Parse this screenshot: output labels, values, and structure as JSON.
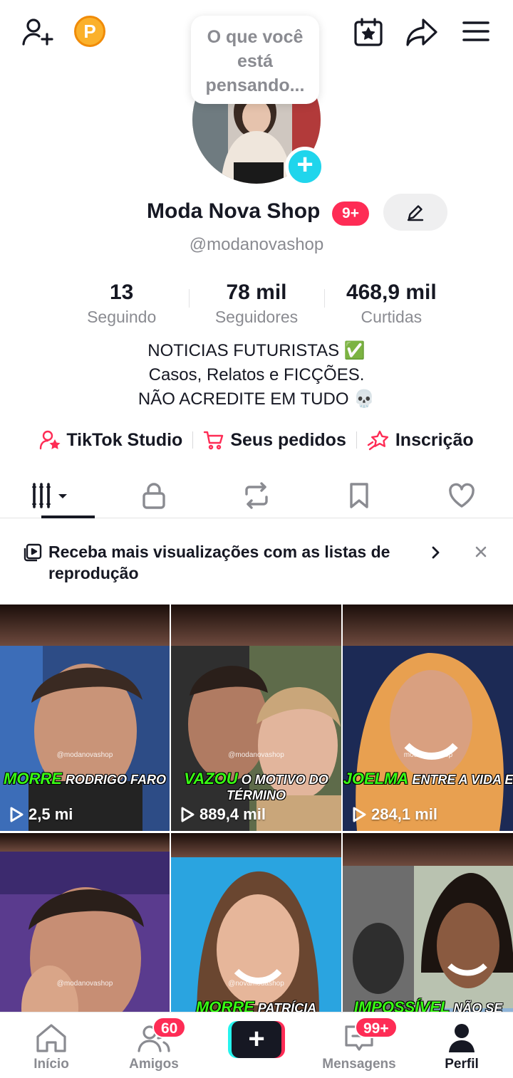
{
  "header": {
    "coin_letter": "P",
    "thought_bubble": "O que você está pensando..."
  },
  "profile": {
    "display_name": "Moda Nova Shop",
    "name_badge": "9+",
    "handle": "@modanovashop"
  },
  "stats": [
    {
      "value": "13",
      "label": "Seguindo"
    },
    {
      "value": "78 mil",
      "label": "Seguidores"
    },
    {
      "value": "468,9 mil",
      "label": "Curtidas"
    }
  ],
  "bio": {
    "line1": "NOTICIAS FUTURISTAS ✅",
    "line2": "Casos, Relatos e FICÇÕES.",
    "line3": "NÃO ACREDITE EM TUDO 💀"
  },
  "quick_links": [
    {
      "label": "TikTok Studio"
    },
    {
      "label": "Seus pedidos"
    },
    {
      "label": "Inscrição"
    }
  ],
  "banner": {
    "text": "Receba mais visualizações com as listas de reprodução"
  },
  "videos": [
    {
      "handle": "@modanovashop",
      "highlight": "MORRE",
      "caption": "RODRIGO FARO",
      "views": "2,5 mi"
    },
    {
      "handle": "@modanovashop",
      "highlight": "VAZOU",
      "caption": "O MOTIVO DO TÉRMINO",
      "views": "889,4 mil"
    },
    {
      "handle": "modanovashop",
      "highlight": "JOELMA",
      "caption": "ENTRE A VIDA E",
      "views": "284,1 mil"
    },
    {
      "handle": "@modanovashop",
      "highlight": "",
      "caption": "",
      "views": ""
    },
    {
      "handle": "@novamodashop",
      "highlight": "MORRE",
      "caption": "PATRÍCIA BRAVANEL",
      "views": ""
    },
    {
      "handle": "",
      "highlight": "IMPOSSÍVEL",
      "caption": "NÃO SE",
      "views": ""
    }
  ],
  "nav": {
    "home": "Início",
    "friends": "Amigos",
    "friends_badge": "60",
    "create": "+",
    "inbox": "Mensagens",
    "inbox_badge": "99+",
    "profile": "Perfil"
  },
  "colors": {
    "accent": "#fe2c55",
    "cyan": "#20d5ec",
    "text_primary": "#161823",
    "text_secondary": "#8a8b91"
  }
}
